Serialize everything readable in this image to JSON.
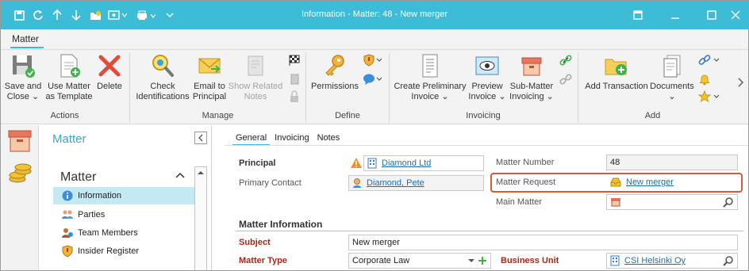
{
  "titlebar": {
    "title": "Information - Matter: 48 - New merger",
    "bg": "#3cbcd6"
  },
  "ribbon": {
    "tab": "Matter",
    "groups": [
      {
        "label": "Actions"
      },
      {
        "label": "Manage"
      },
      {
        "label": "Define"
      },
      {
        "label": "Invoicing"
      },
      {
        "label": "Add"
      }
    ],
    "buttons": {
      "save_close": "Save and\nClose ⌄",
      "use_template": "Use Matter\nas Template",
      "delete": "Delete",
      "check_ids": "Check\nIdentifications",
      "email_principal": "Email to\nPrincipal",
      "show_related": "Show Related\nNotes",
      "permissions": "Permissions",
      "create_prelim": "Create Preliminary\nInvoice ⌄",
      "preview_invoice": "Preview\nInvoice ⌄",
      "submatter_invoicing": "Sub-Matter\nInvoicing ⌄",
      "add_transaction": "Add Transaction",
      "documents": "Documents\n⌄"
    }
  },
  "nav": {
    "panel_title": "Matter",
    "section": "Matter",
    "items": [
      {
        "label": "Information"
      },
      {
        "label": "Parties"
      },
      {
        "label": "Team Members"
      },
      {
        "label": "Insider Register"
      }
    ]
  },
  "main": {
    "tabs": [
      "General",
      "Invoicing",
      "Notes"
    ],
    "principal_label": "Principal",
    "principal_value": "Diamond Ltd",
    "primary_contact_label": "Primary Contact",
    "primary_contact_value": "Diamond, Pete",
    "matter_number_label": "Matter Number",
    "matter_number_value": "48",
    "matter_request_label": "Matter Request",
    "matter_request_value": "New merger",
    "main_matter_label": "Main Matter",
    "section_title": "Matter Information",
    "subject_label": "Subject",
    "subject_value": "New merger",
    "matter_type_label": "Matter Type",
    "matter_type_value": "Corporate Law",
    "business_unit_label": "Business Unit",
    "business_unit_value": "CSI Helsinki Oy"
  }
}
